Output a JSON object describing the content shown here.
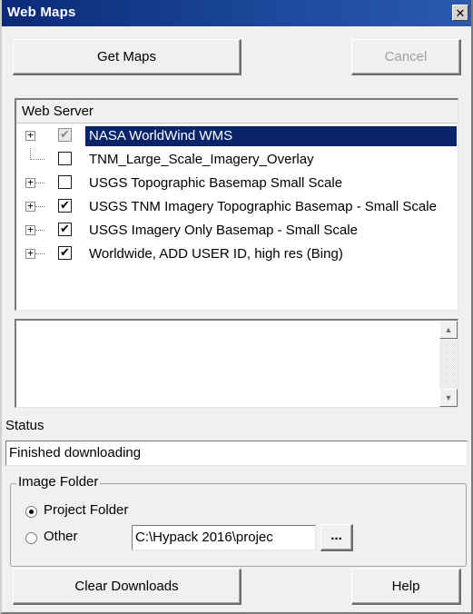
{
  "window": {
    "title": "Web Maps",
    "close_glyph": "✕"
  },
  "toolbar": {
    "get_maps_label": "Get Maps",
    "cancel_label": "Cancel"
  },
  "tree": {
    "header": "Web Server",
    "items": [
      {
        "label": "NASA WorldWind WMS",
        "checked": true,
        "expandable": true,
        "selected": true
      },
      {
        "label": "TNM_Large_Scale_Imagery_Overlay",
        "checked": false,
        "expandable": false,
        "selected": false
      },
      {
        "label": "USGS Topographic Basemap Small Scale",
        "checked": false,
        "expandable": true,
        "selected": false
      },
      {
        "label": "USGS TNM Imagery Topographic Basemap - Small Scale",
        "checked": true,
        "expandable": true,
        "selected": false
      },
      {
        "label": "USGS Imagery Only Basemap - Small Scale",
        "checked": true,
        "expandable": true,
        "selected": false
      },
      {
        "label": "Worldwide, ADD USER ID, high res (Bing)",
        "checked": true,
        "expandable": true,
        "selected": false
      }
    ]
  },
  "status": {
    "label": "Status",
    "value": "Finished downloading"
  },
  "image_folder": {
    "legend": "Image Folder",
    "project_folder_label": "Project Folder",
    "other_label": "Other",
    "path_value": "C:\\Hypack 2016\\projec",
    "browse_label": "...",
    "selected": "project"
  },
  "footer": {
    "clear_label": "Clear Downloads",
    "help_label": "Help"
  },
  "icons": {
    "expand": "+",
    "check": "✔",
    "scroll_up": "▲",
    "scroll_down": "▼"
  },
  "colors": {
    "titlebar": "#1c4a9c",
    "selection": "#0a246a",
    "window_bg": "#f0f0f0"
  }
}
